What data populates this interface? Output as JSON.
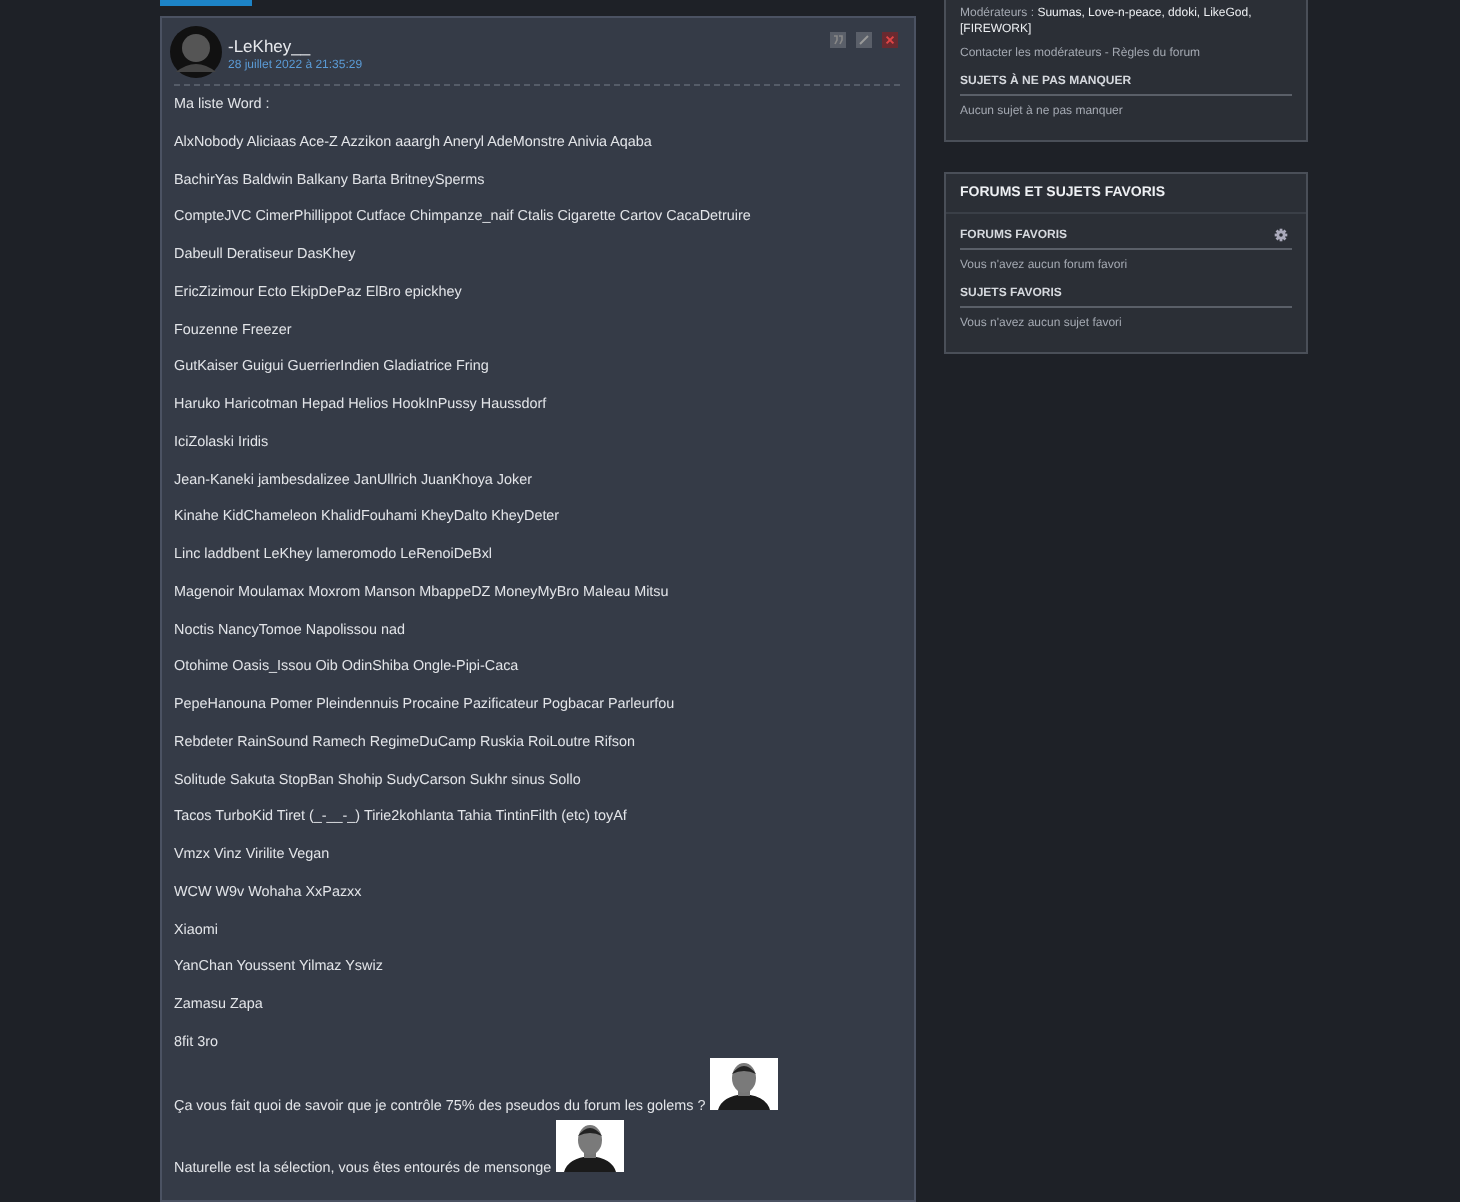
{
  "post": {
    "author": "-LeKhey__",
    "date": "28 juillet 2022 à 21:35:29",
    "actions": [
      {
        "kind": "quote"
      },
      {
        "kind": "edit"
      },
      {
        "kind": "delete"
      }
    ],
    "body": [
      {
        "kind": "text",
        "text": "Ma liste Word :"
      },
      {
        "kind": "text",
        "text": "AlxNobody Aliciaas Ace-Z Azzikon aaargh Aneryl AdeMonstre Anivia Aqaba"
      },
      {
        "kind": "text",
        "text": "BachirYas Baldwin Balkany Barta BritneySperms"
      },
      {
        "kind": "text",
        "text": "CompteJVC CimerPhillippot Cutface Chimpanze_naif Ctalis Cigarette Cartov CacaDetruire"
      },
      {
        "kind": "text",
        "text": "Dabeull Deratiseur DasKhey"
      },
      {
        "kind": "text",
        "text": "EricZizimour Ecto EkipDePaz ElBro epickhey"
      },
      {
        "kind": "text",
        "text": "Fouzenne Freezer"
      },
      {
        "kind": "text",
        "text": "GutKaiser Guigui GuerrierIndien Gladiatrice Fring"
      },
      {
        "kind": "text",
        "text": "Haruko Haricotman Hepad Helios HookInPussy Haussdorf"
      },
      {
        "kind": "text",
        "text": "IciZolaski Iridis"
      },
      {
        "kind": "text",
        "text": "Jean-Kaneki jambesdalizee JanUllrich JuanKhoya Joker"
      },
      {
        "kind": "text",
        "text": "Kinahe KidChameleon KhalidFouhami KheyDalto KheyDeter"
      },
      {
        "kind": "text",
        "text": "Linc laddbent LeKhey lameromodo LeRenoiDeBxl"
      },
      {
        "kind": "text",
        "text": "Magenoir Moulamax Moxrom Manson MbappeDZ MoneyMyBro Maleau Mitsu"
      },
      {
        "kind": "text",
        "text": "Noctis NancyTomoe Napolissou nad"
      },
      {
        "kind": "text",
        "text": "Otohime Oasis_Issou Oib OdinShiba Ongle-Pipi-Caca"
      },
      {
        "kind": "text",
        "text": "PepeHanouna Pomer Pleindennuis Procaine Pazificateur Pogbacar Parleurfou"
      },
      {
        "kind": "text",
        "text": "Rebdeter RainSound Ramech RegimeDuCamp Ruskia RoiLoutre Rifson"
      },
      {
        "kind": "text",
        "text": "Solitude Sakuta StopBan Shohip SudyCarson Sukhr sinus Sollo"
      },
      {
        "kind": "text",
        "text": "Tacos TurboKid Tiret (_-__-_) Tirie2kohlanta Tahia TintinFilth (etc) toyAf"
      },
      {
        "kind": "text",
        "text": "Vmzx Vinz Virilite Vegan"
      },
      {
        "kind": "text",
        "text": "WCW W9v Wohaha XxPazxx"
      },
      {
        "kind": "text",
        "text": "Xiaomi"
      },
      {
        "kind": "text",
        "text": "YanChan Youssent Yilmaz Yswiz"
      },
      {
        "kind": "text",
        "text": "Zamasu Zapa"
      },
      {
        "kind": "text",
        "text": "8fit 3ro"
      },
      {
        "kind": "text-with-picture",
        "text": "Ça vous fait quoi de savoir que je contrôle 75% des pseudos du forum les golems ?"
      },
      {
        "kind": "text-with-picture",
        "text": "Naturelle est la sélection, vous êtes entourés de mensonge"
      }
    ]
  },
  "sidebar": {
    "boxes": [
      {
        "sections": [
          {
            "kind": "text",
            "text": "Modérateurs : **Suumas, Love-n-peace, ddoki, LikeGod, [FIREWORK]**"
          },
          {
            "kind": "text",
            "text": "Contacter les modérateurs - Règles du forum"
          },
          {
            "kind": "heading",
            "text": "SUJETS À NE PAS MANQUER",
            "settings": false
          },
          {
            "kind": "text",
            "text": "Aucun sujet à ne pas manquer"
          }
        ]
      },
      {
        "title": "FORUMS ET SUJETS FAVORIS",
        "sections": [
          {
            "kind": "heading",
            "text": "FORUMS FAVORIS",
            "settings": true
          },
          {
            "kind": "text",
            "text": "Vous n'avez aucun forum favori"
          },
          {
            "kind": "heading",
            "text": "SUJETS FAVORIS",
            "settings": false
          },
          {
            "kind": "text",
            "text": "Vous n'avez aucun sujet favori"
          }
        ]
      }
    ]
  }
}
